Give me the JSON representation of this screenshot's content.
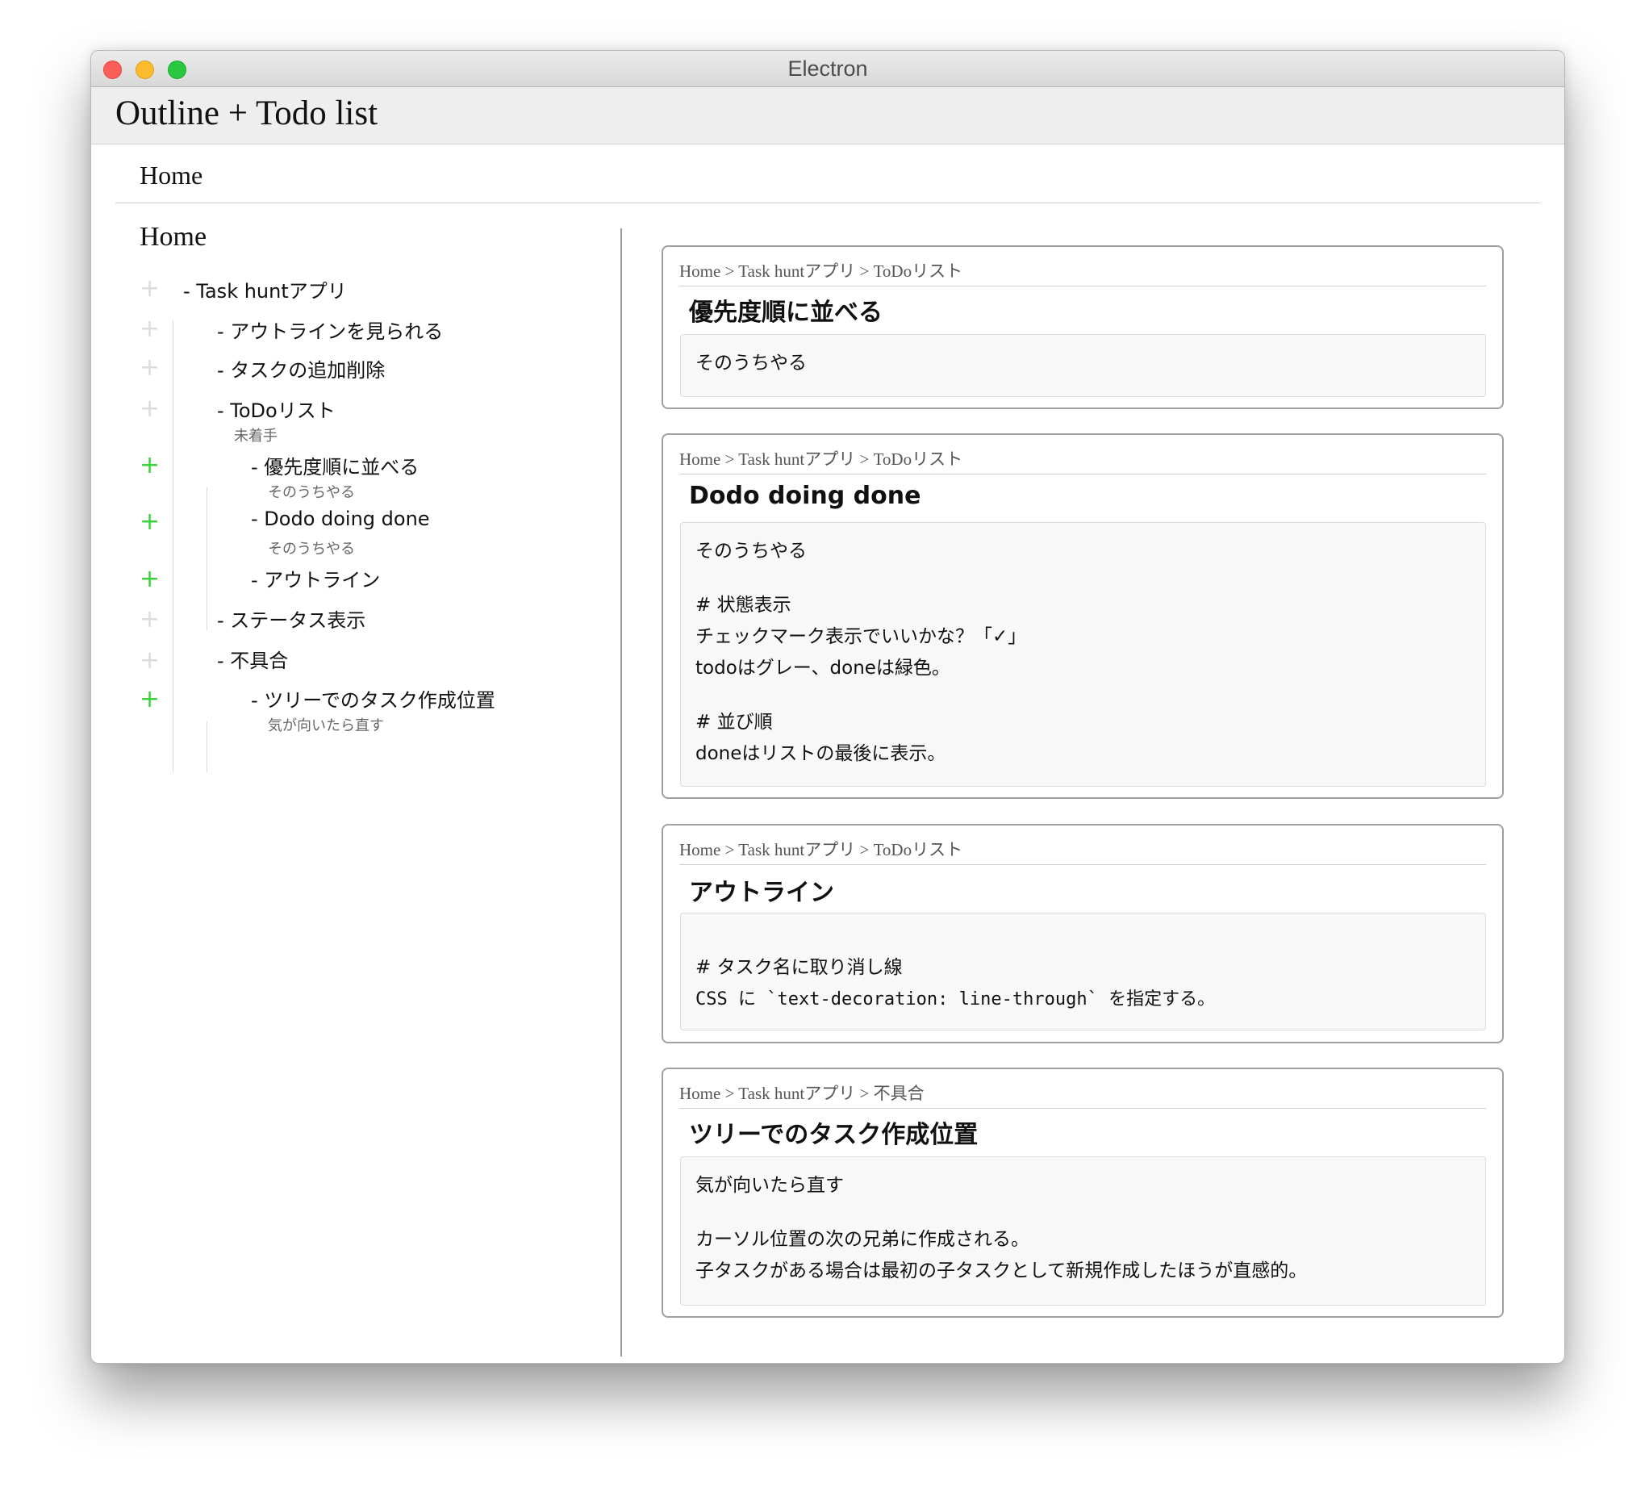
{
  "window": {
    "title": "Electron"
  },
  "app": {
    "title": "Outline + Todo list",
    "breadcrumb": "Home"
  },
  "tree": {
    "root": "Home",
    "nodes": [
      {
        "label": "- Task huntアプリ",
        "expanded": false
      },
      {
        "label": "- アウトラインを見られる",
        "expanded": false
      },
      {
        "label": "- タスクの追加削除",
        "expanded": false
      },
      {
        "label": "- ToDoリスト",
        "note": "未着手",
        "expanded": false
      },
      {
        "label": "- 優先度順に並べる",
        "note": "そのうちやる",
        "expanded": true
      },
      {
        "label": "- Dodo doing done",
        "note": "そのうちやる",
        "expanded": true
      },
      {
        "label": "- アウトライン",
        "expanded": true
      },
      {
        "label": "- ステータス表示",
        "expanded": false
      },
      {
        "label": "- 不具合",
        "expanded": false
      },
      {
        "label": "- ツリーでのタスク作成位置",
        "note": "気が向いたら直す",
        "expanded": true
      }
    ]
  },
  "cards": [
    {
      "breadcrumb": "Home > Task huntアプリ > ToDoリスト",
      "title": "優先度順に並べる",
      "lines": [
        "そのうちやる"
      ]
    },
    {
      "breadcrumb": "Home > Task huntアプリ > ToDoリスト",
      "title": "Dodo doing done",
      "lines": [
        "そのうちやる",
        "",
        "# 状態表示",
        "チェックマーク表示でいいかな？「✓」",
        "todoはグレー、doneは緑色。",
        "",
        "# 並び順",
        "doneはリストの最後に表示。"
      ]
    },
    {
      "breadcrumb": "Home > Task huntアプリ > ToDoリスト",
      "title": "アウトライン",
      "lines": [
        "",
        "# タスク名に取り消し線",
        "CSS に `text-decoration: line-through` を指定する。"
      ]
    },
    {
      "breadcrumb": "Home > Task huntアプリ > 不具合",
      "title": "ツリーでのタスク作成位置",
      "lines": [
        "気が向いたら直す",
        "",
        "カーソル位置の次の兄弟に作成される。",
        "子タスクがある場合は最初の子タスクとして新規作成したほうが直感的。"
      ]
    }
  ]
}
